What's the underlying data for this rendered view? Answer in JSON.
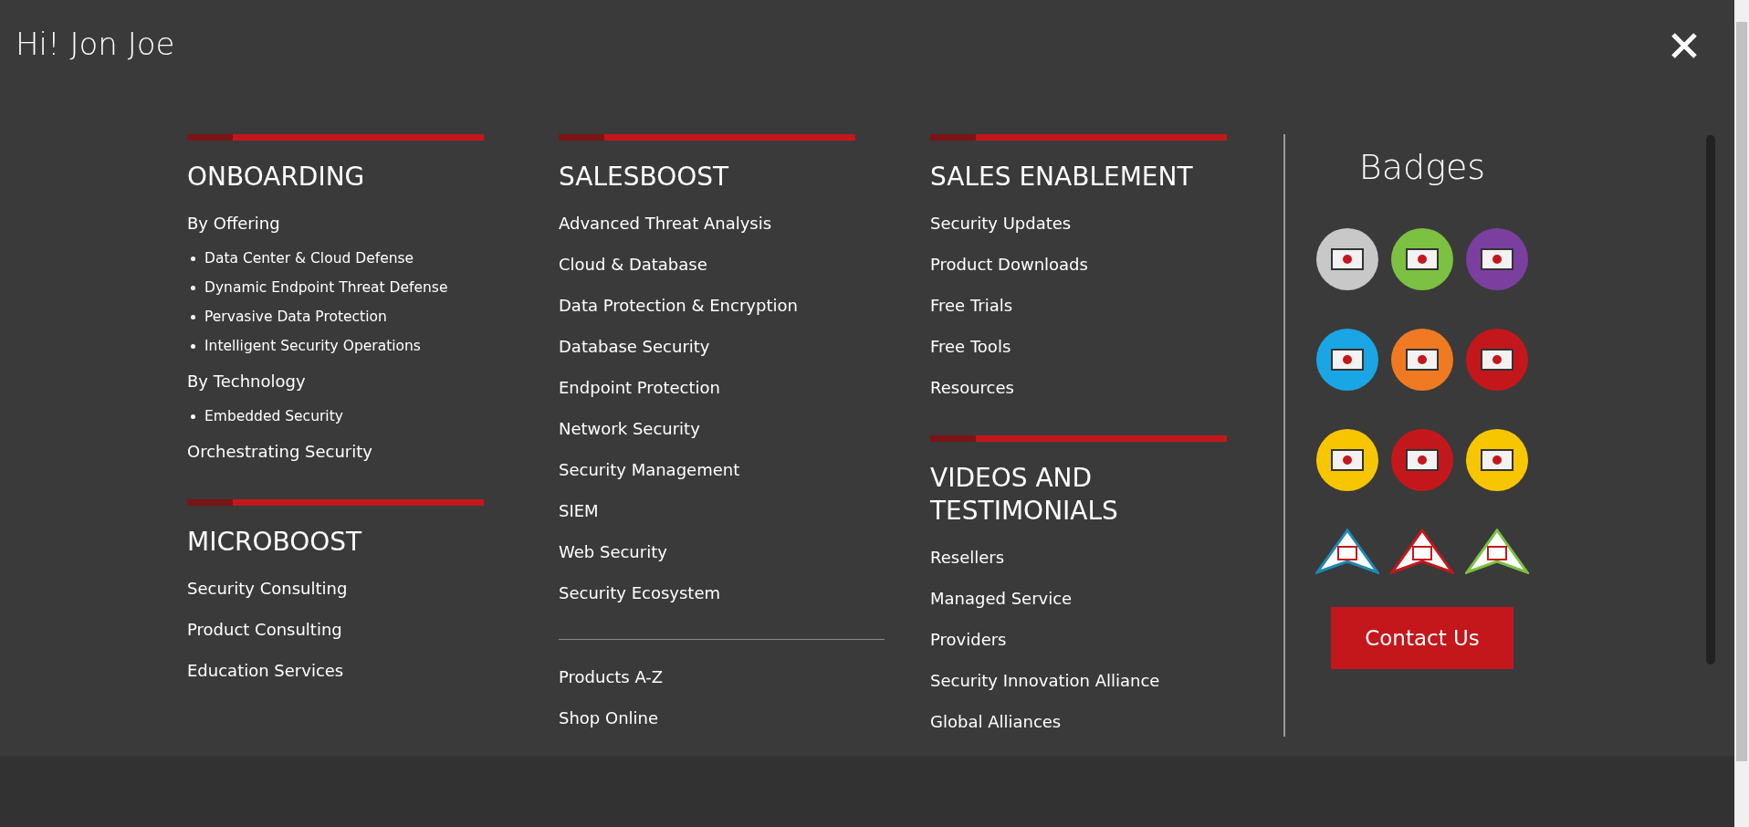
{
  "greeting": "Hi! Jon Joe",
  "columns": [
    {
      "sections": [
        {
          "title": "ONBOARDING",
          "items": [
            {
              "kind": "link",
              "label": "By Offering"
            },
            {
              "kind": "bullet",
              "label": "Data Center & Cloud Defense"
            },
            {
              "kind": "bullet",
              "label": "Dynamic Endpoint Threat Defense"
            },
            {
              "kind": "bullet",
              "label": "Pervasive Data Protection"
            },
            {
              "kind": "bullet",
              "label": "Intelligent Security Operations"
            },
            {
              "kind": "link",
              "label": "By Technology"
            },
            {
              "kind": "bullet",
              "label": "Embedded Security"
            },
            {
              "kind": "link",
              "label": "Orchestrating Security"
            }
          ]
        },
        {
          "title": "MICROBOOST",
          "items": [
            {
              "kind": "link",
              "label": "Security Consulting"
            },
            {
              "kind": "link",
              "label": "Product Consulting"
            },
            {
              "kind": "link",
              "label": "Education Services"
            }
          ]
        }
      ]
    },
    {
      "sections": [
        {
          "title": "SALESBOOST",
          "items": [
            {
              "kind": "link",
              "label": "Advanced Threat Analysis"
            },
            {
              "kind": "link",
              "label": "Cloud & Database"
            },
            {
              "kind": "link",
              "label": "Data Protection & Encryption"
            },
            {
              "kind": "link",
              "label": "Database Security"
            },
            {
              "kind": "link",
              "label": "Endpoint Protection"
            },
            {
              "kind": "link",
              "label": "Network Security"
            },
            {
              "kind": "link",
              "label": "Security Management"
            },
            {
              "kind": "link",
              "label": "SIEM"
            },
            {
              "kind": "link",
              "label": "Web Security"
            },
            {
              "kind": "link",
              "label": "Security Ecosystem"
            }
          ]
        }
      ],
      "footer_links": [
        "Products A-Z",
        "Shop Online"
      ]
    },
    {
      "sections": [
        {
          "title": "SALES ENABLEMENT",
          "items": [
            {
              "kind": "link",
              "label": "Security Updates"
            },
            {
              "kind": "link",
              "label": "Product Downloads"
            },
            {
              "kind": "link",
              "label": "Free Trials"
            },
            {
              "kind": "link",
              "label": "Free Tools"
            },
            {
              "kind": "link",
              "label": "Resources"
            }
          ]
        },
        {
          "title": "VIDEOS AND TESTIMONIALS",
          "items": [
            {
              "kind": "link",
              "label": "Resellers"
            },
            {
              "kind": "link",
              "label": "Managed Service"
            },
            {
              "kind": "link",
              "label": "Providers"
            },
            {
              "kind": "link",
              "label": "Security Innovation Alliance"
            },
            {
              "kind": "link",
              "label": "Global Alliances"
            }
          ]
        }
      ]
    }
  ],
  "badges": {
    "title": "Badges",
    "items": [
      {
        "kind": "circle",
        "color": "#c8c8c8"
      },
      {
        "kind": "circle",
        "color": "#7cc142"
      },
      {
        "kind": "circle",
        "color": "#7b3fa0"
      },
      {
        "kind": "circle",
        "color": "#1aa6e4"
      },
      {
        "kind": "circle",
        "color": "#f07a22"
      },
      {
        "kind": "circle",
        "color": "#c4171c"
      },
      {
        "kind": "circle",
        "color": "#f7c600"
      },
      {
        "kind": "circle",
        "color": "#c4171c"
      },
      {
        "kind": "circle",
        "color": "#f7c600"
      },
      {
        "kind": "triangle",
        "color": "#1e88b4"
      },
      {
        "kind": "triangle",
        "color": "#c4171c"
      },
      {
        "kind": "triangle",
        "color": "#7cc142"
      }
    ]
  },
  "contact_button": "Contact Us"
}
